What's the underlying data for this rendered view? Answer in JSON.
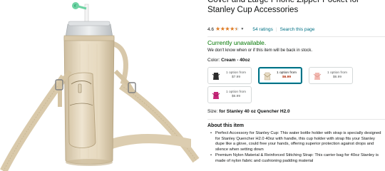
{
  "product": {
    "title": "Cover and Large Phone Zipper Pocket for Stanley Cup Accessories",
    "rating": "4.6",
    "ratings_count": "54 ratings",
    "search_link": "Search this page",
    "availability": "Currently unavailable.",
    "availability_note": "We don't know when or if this item will be back in stock.",
    "color_label": "Color:",
    "color_value": "Cream - 40oz",
    "size_label": "Size:",
    "size_value": "for Stanley 40 oz Quencher H2.0",
    "about_heading": "About this item"
  },
  "swatches": [
    {
      "line1": "1 option from",
      "price": "$7.99",
      "thumb_color": "#2c2c2c",
      "selected": false
    },
    {
      "line1": "1 option from",
      "price": "$6.99",
      "thumb_color": "#e8dcc4",
      "selected": true
    },
    {
      "line1": "1 option from",
      "price": "$6.99",
      "thumb_color": "#f2b8b0",
      "selected": false
    },
    {
      "line1": "1 option from",
      "price": "$6.99",
      "thumb_color": "#c7287a",
      "selected": false
    }
  ],
  "bullets": [
    "Perfect Accessory for Stanley Cup: This water bottle holder with strap is specially designed for Stanley Quencher H2.0 40oz with handle, this cup holder with strap fits your Stanley dupe like a glove, could free your hands, offering superior protection against drops and silence when setting down",
    "Premium Nylon Material & Reinforced Stitching Strap: This carrier bag for 40oz Stanley is made of nylon fabric and cushioning padding material"
  ],
  "colors": {
    "link": "#007185",
    "in_stock_green": "#007600",
    "star": "#de7921",
    "price_red": "#b12704",
    "product_beige": "#e3d5bb"
  }
}
